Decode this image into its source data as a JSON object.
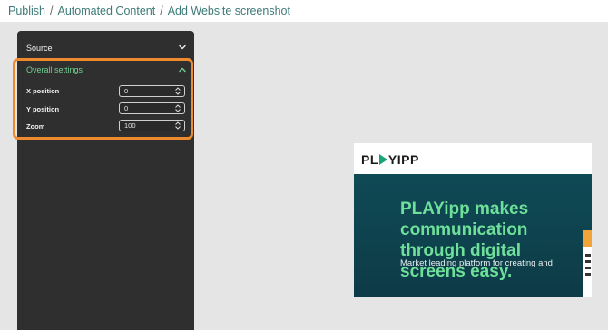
{
  "breadcrumb": {
    "items": [
      "Publish",
      "Automated Content",
      "Add Website screenshot"
    ],
    "separator": "/"
  },
  "sidebar": {
    "source_label": "Source",
    "overall_settings_label": "Overall settings",
    "fields": [
      {
        "label": "X position",
        "value": "0"
      },
      {
        "label": "Y position",
        "value": "0"
      },
      {
        "label": "Zoom",
        "value": "100"
      }
    ]
  },
  "preview": {
    "logo": "PLAYIPP",
    "headline": "PLAYipp makes communication through digital screens easy.",
    "subline": "Market leading platform for creating and"
  },
  "colors": {
    "accent_green": "#6fcf8e",
    "highlight_orange": "#ef8a2e",
    "breadcrumb_teal": "#3d7a78",
    "panel_dark": "#2f2f2f"
  },
  "icons": [
    "chevron-down-icon",
    "chevron-up-icon",
    "spinner-arrows-icon",
    "play-logo-icon"
  ]
}
